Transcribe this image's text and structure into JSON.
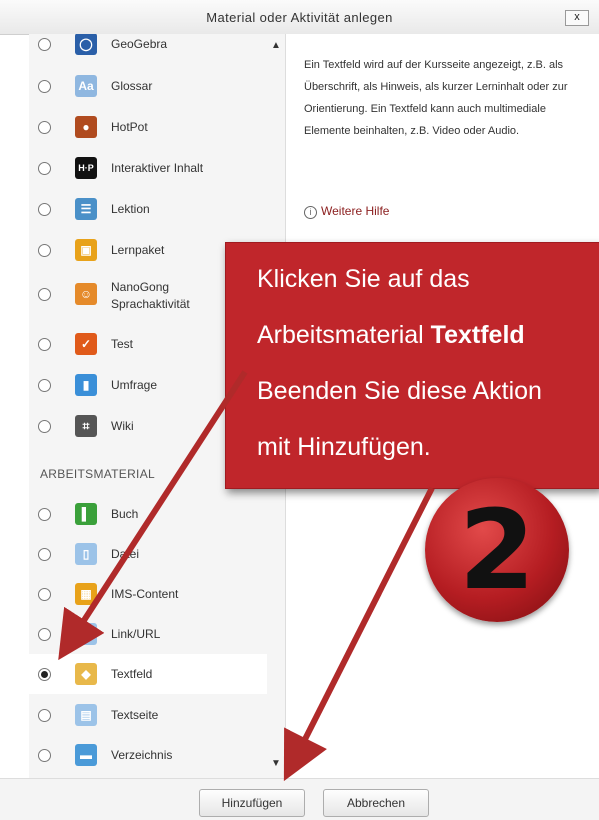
{
  "dialog": {
    "title": "Material oder Aktivität anlegen",
    "close_label": "x"
  },
  "activities": [
    {
      "label": "GeoGebra",
      "icon": "geogebra-icon",
      "color": "#2a5fa8",
      "glyph": "◯"
    },
    {
      "label": "Glossar",
      "icon": "glossary-icon",
      "color": "#8fb7e0",
      "glyph": "Aa"
    },
    {
      "label": "HotPot",
      "icon": "hotpot-icon",
      "color": "#b04b1f",
      "glyph": "●"
    },
    {
      "label": "Interaktiver Inhalt",
      "icon": "h5p-icon",
      "color": "#111111",
      "glyph": "H·P"
    },
    {
      "label": "Lektion",
      "icon": "lesson-icon",
      "color": "#4a90c8",
      "glyph": "☰"
    },
    {
      "label": "Lernpaket",
      "icon": "package-icon",
      "color": "#e8a21a",
      "glyph": "▣"
    },
    {
      "label": "NanoGong",
      "label2": "Sprachaktivität",
      "icon": "nanogong-icon",
      "color": "#e58a2a",
      "glyph": "☺"
    },
    {
      "label": "Test",
      "icon": "quiz-icon",
      "color": "#e05a1a",
      "glyph": "✓"
    },
    {
      "label": "Umfrage",
      "icon": "survey-icon",
      "color": "#3a8fd8",
      "glyph": "▮"
    },
    {
      "label": "Wiki",
      "icon": "wiki-icon",
      "color": "#555555",
      "glyph": "⌗"
    }
  ],
  "section_header": "ARBEITSMATERIAL",
  "resources": [
    {
      "label": "Buch",
      "icon": "book-icon",
      "color": "#3aa03a",
      "glyph": "▌"
    },
    {
      "label": "Datei",
      "icon": "file-icon",
      "color": "#9cc3e8",
      "glyph": "▯"
    },
    {
      "label": "IMS-Content",
      "icon": "ims-content-icon",
      "color": "#e8a21a",
      "glyph": "▦"
    },
    {
      "label": "Link/URL",
      "icon": "link-icon",
      "color": "#9cc3e8",
      "glyph": "▯"
    },
    {
      "label": "Textfeld",
      "icon": "label-icon",
      "color": "#e8b84a",
      "glyph": "◆",
      "selected": true
    },
    {
      "label": "Textseite",
      "icon": "page-icon",
      "color": "#9cc3e8",
      "glyph": "▤"
    },
    {
      "label": "Verzeichnis",
      "icon": "folder-icon",
      "color": "#4a9ad8",
      "glyph": "▬"
    }
  ],
  "description": "Ein Textfeld wird auf der Kursseite angezeigt, z.B. als Überschrift, als Hinweis, als kurzer Lerninhalt oder zur Orientierung. Ein Textfeld kann auch multimediale Elemente beinhalten, z.B. Video oder Audio.",
  "help_link": "Weitere Hilfe",
  "buttons": {
    "add": "Hinzufügen",
    "cancel": "Abbrechen"
  },
  "callout": {
    "line1": "Klicken Sie auf das",
    "line2_prefix": "Arbeitsmaterial ",
    "line2_bold": "Textfeld",
    "line3": "Beenden Sie diese Aktion",
    "line4": "mit Hinzufügen.",
    "step_number": "2",
    "color": "#c0262b"
  }
}
